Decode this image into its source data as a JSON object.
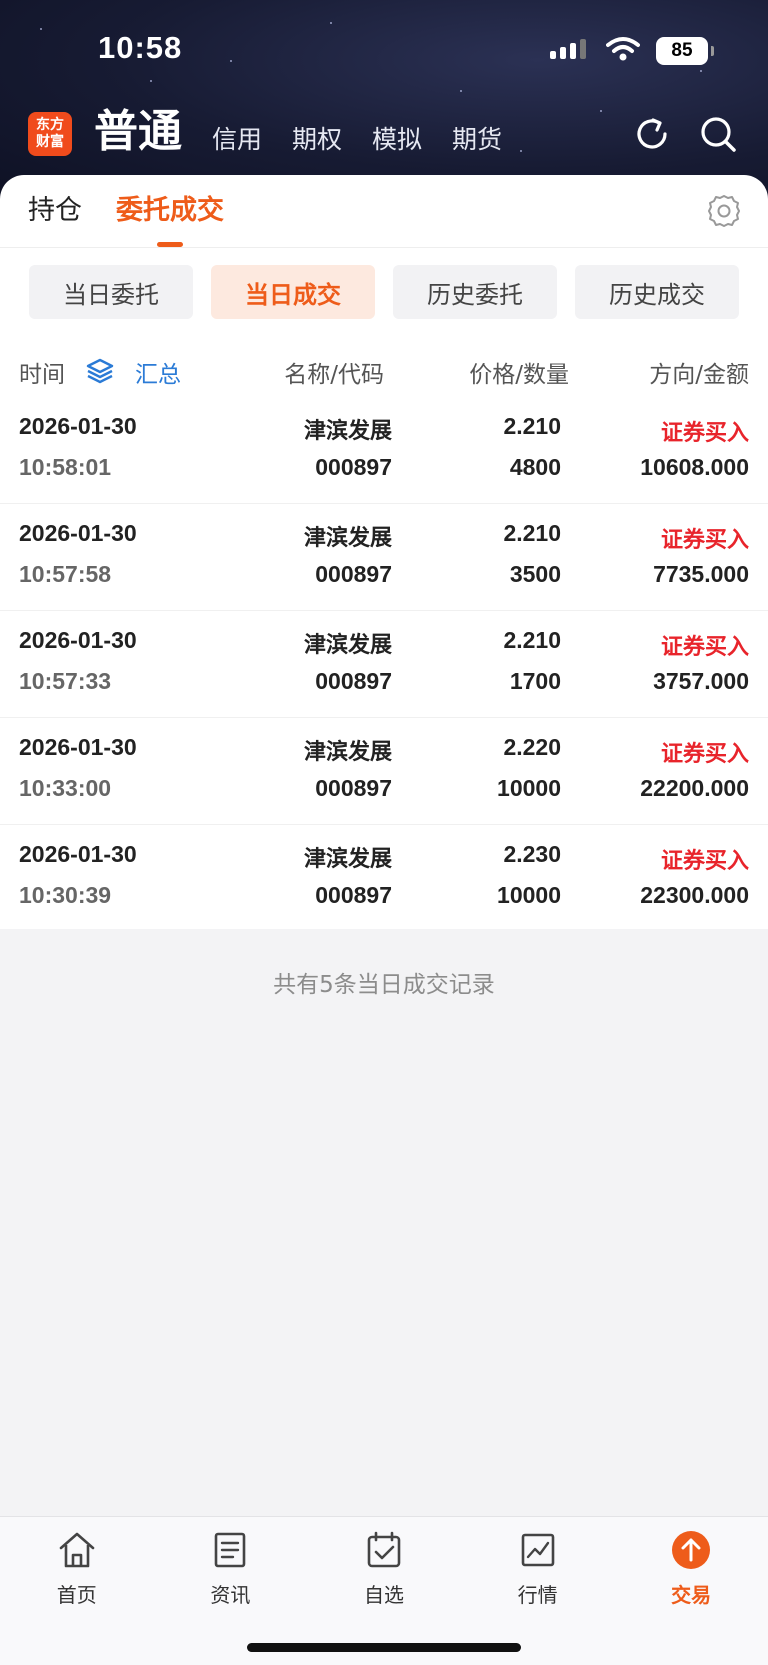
{
  "status": {
    "time": "10:58",
    "battery": "85"
  },
  "header": {
    "logo_line1": "东方",
    "logo_line2": "财富",
    "account_types": [
      "普通",
      "信用",
      "期权",
      "模拟",
      "期货"
    ],
    "active_account": "普通"
  },
  "tabs": {
    "holdings": "持仓",
    "orders_trades": "委托成交"
  },
  "filters": [
    "当日委托",
    "当日成交",
    "历史委托",
    "历史成交"
  ],
  "table": {
    "headers": {
      "time": "时间",
      "summary": "汇总",
      "name_code": "名称/代码",
      "price_qty": "价格/数量",
      "dir_amount": "方向/金额"
    },
    "rows": [
      {
        "date": "2026-01-30",
        "time": "10:58:01",
        "name": "津滨发展",
        "code": "000897",
        "price": "2.210",
        "qty": "4800",
        "direction": "证券买入",
        "amount": "10608.000"
      },
      {
        "date": "2026-01-30",
        "time": "10:57:58",
        "name": "津滨发展",
        "code": "000897",
        "price": "2.210",
        "qty": "3500",
        "direction": "证券买入",
        "amount": "7735.000"
      },
      {
        "date": "2026-01-30",
        "time": "10:57:33",
        "name": "津滨发展",
        "code": "000897",
        "price": "2.210",
        "qty": "1700",
        "direction": "证券买入",
        "amount": "3757.000"
      },
      {
        "date": "2026-01-30",
        "time": "10:33:00",
        "name": "津滨发展",
        "code": "000897",
        "price": "2.220",
        "qty": "10000",
        "direction": "证券买入",
        "amount": "22200.000"
      },
      {
        "date": "2026-01-30",
        "time": "10:30:39",
        "name": "津滨发展",
        "code": "000897",
        "price": "2.230",
        "qty": "10000",
        "direction": "证券买入",
        "amount": "22300.000"
      }
    ]
  },
  "summary_text": "共有5条当日成交记录",
  "bottom_nav": [
    "首页",
    "资讯",
    "自选",
    "行情",
    "交易"
  ],
  "colors": {
    "accent": "#ee5c1a",
    "buy": "#e8242b",
    "header_bg": "#171b33"
  }
}
